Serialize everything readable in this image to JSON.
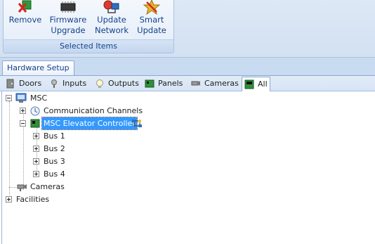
{
  "ribbon": {
    "buttons": [
      {
        "label": "Remove",
        "icon": "remove-icon"
      },
      {
        "label": "Firmware\nUpgrade",
        "icon": "firmware-icon"
      },
      {
        "label": "Update\nNetwork",
        "icon": "network-icon"
      },
      {
        "label": "Smart\nUpdate",
        "icon": "smart-update-icon"
      }
    ],
    "group_label": "Selected Items"
  },
  "hardware_tab": "Hardware Setup",
  "categories": [
    {
      "label": "Doors",
      "icon": "door-icon"
    },
    {
      "label": "Inputs",
      "icon": "input-icon"
    },
    {
      "label": "Outputs",
      "icon": "bulb-icon"
    },
    {
      "label": "Panels",
      "icon": "panel-icon"
    },
    {
      "label": "Cameras",
      "icon": "camera-icon"
    },
    {
      "label": "All",
      "icon": "all-icon",
      "active": true
    }
  ],
  "tree": {
    "root": "MSC",
    "communication_channels": "Communication Channels",
    "controller": "MSC Elevator Controller",
    "buses": [
      "Bus 1",
      "Bus 2",
      "Bus 3",
      "Bus 4"
    ],
    "cameras": "Cameras",
    "facilities": "Facilities"
  }
}
